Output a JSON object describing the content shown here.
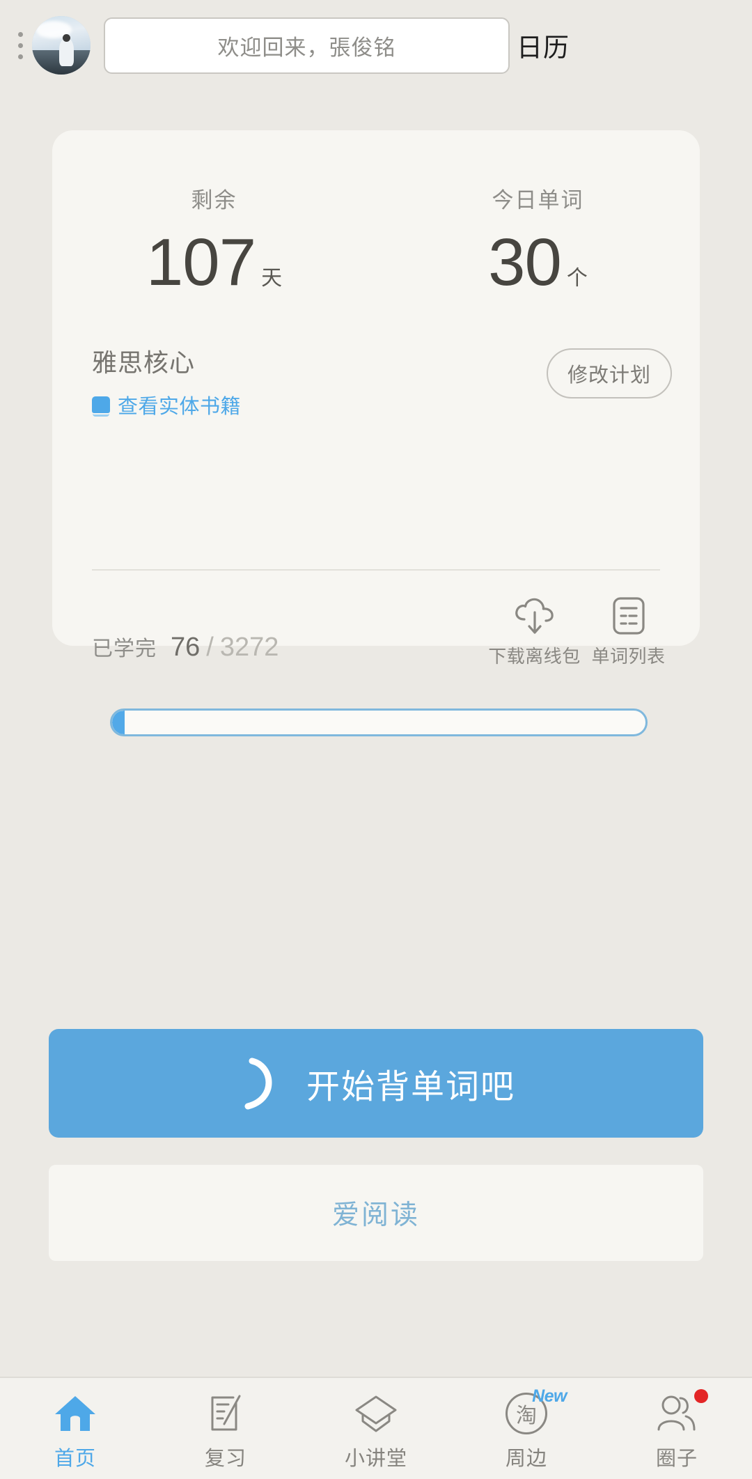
{
  "header": {
    "menu_icon": "kebab-menu-icon",
    "avatar_alt": "user-avatar",
    "welcome_text": "欢迎回来，張俊铭",
    "calendar_label": "日历"
  },
  "card": {
    "stats": [
      {
        "label": "剩余",
        "value": "107",
        "unit": "天"
      },
      {
        "label": "今日单词",
        "value": "30",
        "unit": "个"
      }
    ],
    "book_title": "雅思核心",
    "book_link_label": "查看实体书籍",
    "modify_plan_label": "修改计划",
    "progress": {
      "label": "已学完",
      "done": "76",
      "separator": "/",
      "total": "3272",
      "percent": 2.3
    },
    "actions": [
      {
        "label": "下载离线包",
        "icon": "cloud-download-icon"
      },
      {
        "label": "单词列表",
        "icon": "word-list-icon"
      }
    ]
  },
  "buttons": {
    "start_label": "开始背单词吧",
    "start_icon": "crescent-arc-icon",
    "read_label": "爱阅读"
  },
  "bottom_nav": [
    {
      "label": "首页",
      "icon": "home-icon",
      "active": true,
      "badge": ""
    },
    {
      "label": "复习",
      "icon": "notebook-pen-icon",
      "active": false,
      "badge": ""
    },
    {
      "label": "小讲堂",
      "icon": "graduation-cap-icon",
      "active": false,
      "badge": ""
    },
    {
      "label": "周边",
      "icon": "tao-circle-icon",
      "active": false,
      "badge": "New"
    },
    {
      "label": "圈子",
      "icon": "people-icon",
      "active": false,
      "badge": "dot"
    }
  ],
  "colors": {
    "accent_blue": "#4ea8e8",
    "button_blue": "#5ba7dd",
    "background": "#ebe9e4",
    "card": "#f7f6f2",
    "badge_red": "#e32626",
    "text_dark": "#474540",
    "text_muted": "#8e8d89"
  }
}
